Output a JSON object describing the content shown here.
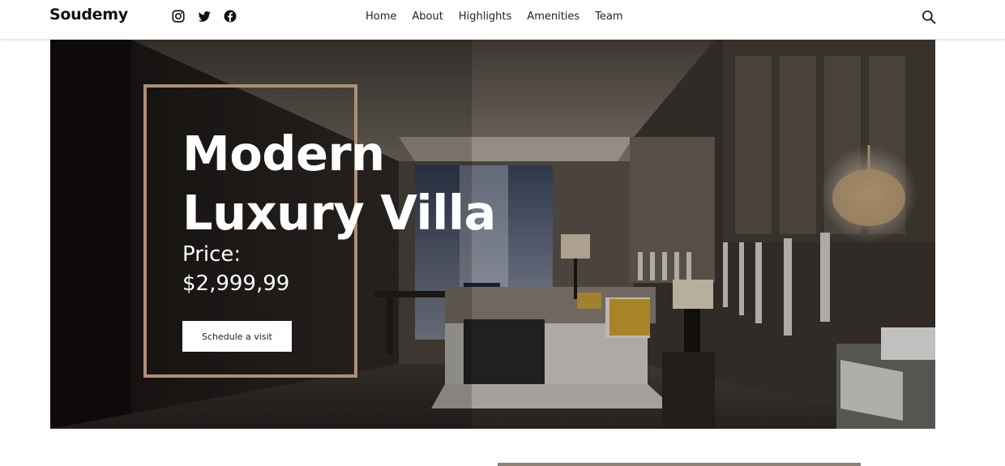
{
  "header": {
    "brand": "Soudemy",
    "socials": [
      {
        "name": "instagram-icon"
      },
      {
        "name": "twitter-icon"
      },
      {
        "name": "facebook-icon"
      }
    ],
    "nav": [
      "Home",
      "About",
      "Highlights",
      "Amenities",
      "Team"
    ],
    "search_icon": "search-icon"
  },
  "hero": {
    "title_line1": "Modern",
    "title_line2": "Luxury Villa",
    "price_label": "Price:",
    "price_value": "$2,999,99",
    "cta_label": "Schedule a visit",
    "frame_color": "#b08f72"
  },
  "colors": {
    "accent": "#b08f72",
    "cta_bg": "#ffffff",
    "bottom_bar": "#8d8178"
  }
}
